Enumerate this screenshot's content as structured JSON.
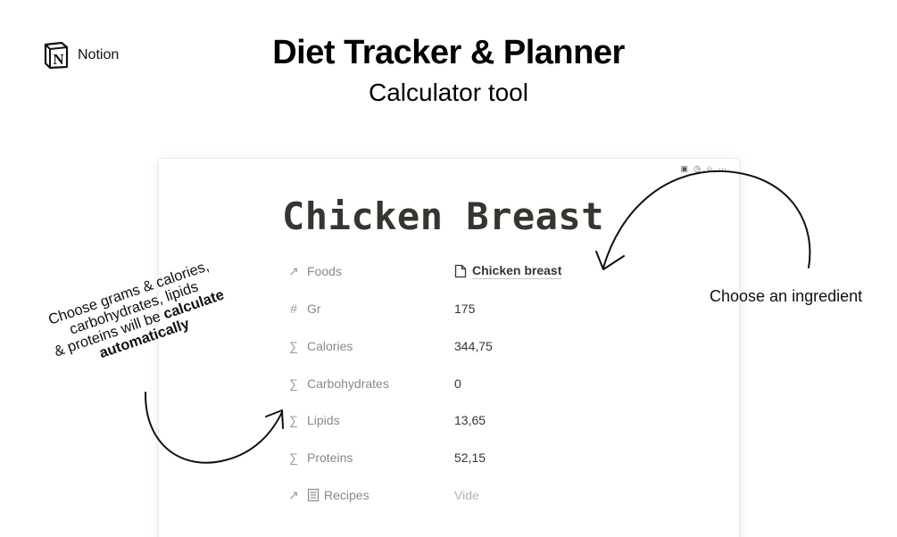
{
  "brand": {
    "logo_letter": "N",
    "name": "Notion"
  },
  "hero": {
    "title": "Diet Tracker & Planner",
    "subtitle": "Calculator tool"
  },
  "page": {
    "title": "Chicken Breast",
    "topbar_icons": [
      "comment-icon",
      "history-icon",
      "star-icon",
      "more-icon"
    ],
    "properties": [
      {
        "icon": "relation-arrow-icon",
        "glyph": "↗",
        "label": "Foods",
        "value": "Chicken breast",
        "value_icon": "page-icon"
      },
      {
        "icon": "number-icon",
        "glyph": "#",
        "label": "Gr",
        "value": "175"
      },
      {
        "icon": "formula-icon",
        "glyph": "∑",
        "label": "Calories",
        "value": "344,75"
      },
      {
        "icon": "formula-icon",
        "glyph": "∑",
        "label": "Carbohydrates",
        "value": "0"
      },
      {
        "icon": "formula-icon",
        "glyph": "∑",
        "label": "Lipids",
        "value": "13,65"
      },
      {
        "icon": "formula-icon",
        "glyph": "∑",
        "label": "Proteins",
        "value": "52,15"
      },
      {
        "icon": "relation-arrow-icon",
        "glyph": "↗",
        "label": "Recipes",
        "label_icon": "document-icon",
        "value": "Vide"
      }
    ]
  },
  "annotations": {
    "right": "Choose an ingredient",
    "left_line1": "Choose grams & calories,",
    "left_line2": "carbohydrates, lipids",
    "left_line3a": "& proteins will be ",
    "left_bold1": "calculate",
    "left_bold2": "automatically"
  }
}
